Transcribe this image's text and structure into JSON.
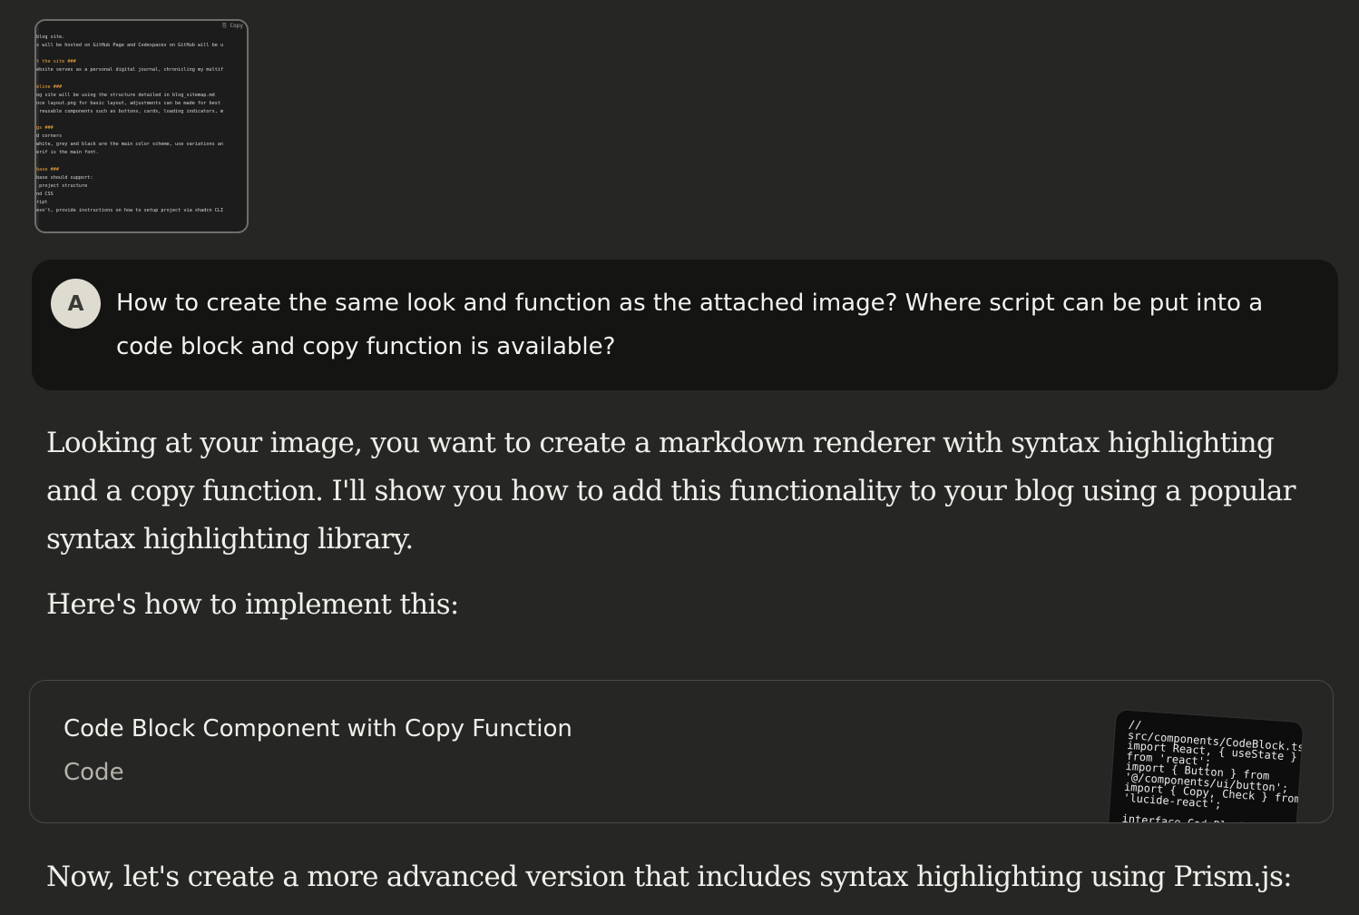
{
  "attachment": {
    "copy_label": "⎘ Copy",
    "lines": [
      {
        "text": "blog site.",
        "hl": false
      },
      {
        "text": "s will be hosted on GitHub Page and Codespaces on GitHub will be u",
        "hl": false
      },
      {
        "text": "",
        "hl": false
      },
      {
        "text": "t the site ###",
        "hl": true
      },
      {
        "text": "ebsite serves as a personal digital journal, chronicling my multif",
        "hl": false
      },
      {
        "text": "",
        "hl": false
      },
      {
        "text": "eline ###",
        "hl": true
      },
      {
        "text": "og site will be using the structure detailed in blog_sitemap.md",
        "hl": false
      },
      {
        "text": "nce layout.png for basic layout, adjustments can be made for best",
        "hl": false
      },
      {
        "text": " reusable components such as buttons, cards, loading indicators, m",
        "hl": false
      },
      {
        "text": "",
        "hl": false
      },
      {
        "text": "gs ###",
        "hl": true
      },
      {
        "text": "d corners",
        "hl": false
      },
      {
        "text": "white, grey and black are the main color scheme, use variations an",
        "hl": false
      },
      {
        "text": "erif is the main font.",
        "hl": false
      },
      {
        "text": "",
        "hl": false
      },
      {
        "text": "base ###",
        "hl": true
      },
      {
        "text": "base should support:",
        "hl": false
      },
      {
        "text": " project structure",
        "hl": false
      },
      {
        "text": "nd CSS",
        "hl": false
      },
      {
        "text": "ript",
        "hl": false
      },
      {
        "text": "esn't, provide instructions on how to setup project via shadcn CLI",
        "hl": false
      }
    ]
  },
  "user_message": {
    "avatar_initial": "A",
    "text": "How to create the same look and function as the attached image? Where script can be put into a code block and copy function is available?"
  },
  "assistant": {
    "paragraph1": "Looking at your image, you want to create a markdown renderer with syntax highlighting and a copy function. I'll show you how to add this functionality to your blog using a popular syntax highlighting library.",
    "paragraph2": "Here's how to implement this:",
    "paragraph3": "Now, let's create a more advanced version that includes syntax highlighting using Prism.js:"
  },
  "artifact": {
    "title": "Code Block Component with Copy Function",
    "type": "Code",
    "preview_code": "//\nsrc/components/CodeBlock.tsx\nimport React, { useState }\nfrom 'react';\nimport { Button } from\n'@/components/ui/button';\nimport { Copy, Check } from\n'lucide-react';\n\ninterface CodeBlockProps"
  }
}
